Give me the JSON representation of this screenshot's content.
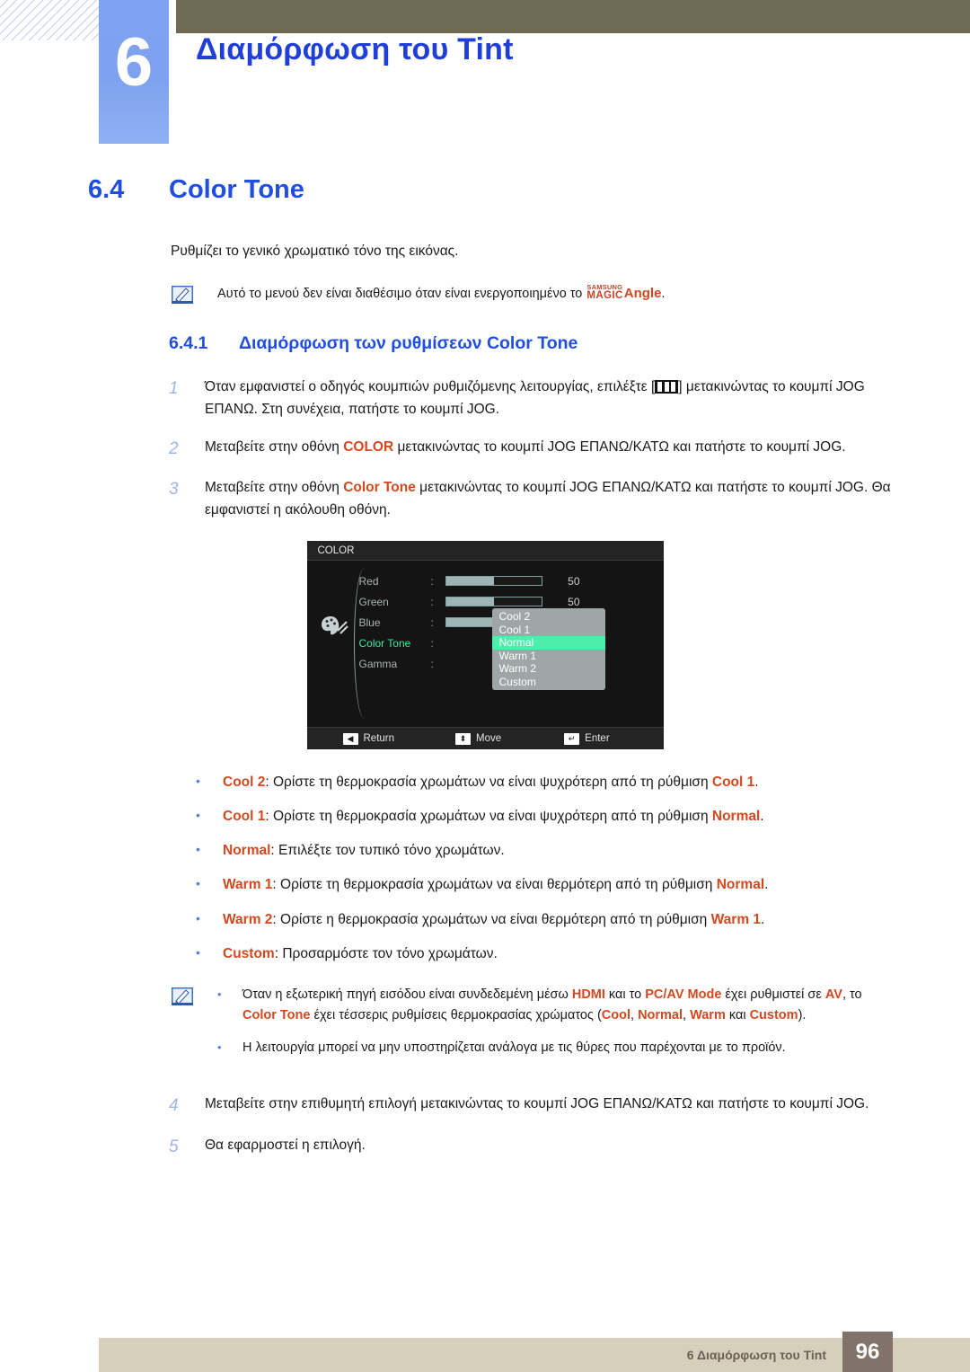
{
  "header": {
    "chapter_number": "6",
    "chapter_title": "Διαμόρφωση του Tint",
    "accent_blue": "#1f3fd8",
    "badge_blue": "#7fa3f0",
    "olive": "#6e6a53"
  },
  "section": {
    "number": "6.4",
    "title": "Color Tone",
    "intro": "Ρυθμίζει το γενικό χρωματικό τόνο της εικόνας."
  },
  "top_note": {
    "icon": "note-pencil-icon",
    "text_before": "Αυτό το μενού δεν είναι διαθέσιμο όταν είναι ενεργοποιημένο το ",
    "logo_line1": "SAMSUNG",
    "logo_line2": "MAGIC",
    "logo_word": "Angle",
    "text_after": "."
  },
  "subsection": {
    "number": "6.4.1",
    "title": "Διαμόρφωση των ρυθμίσεων Color Tone"
  },
  "steps_top": [
    {
      "num": "1",
      "part1": "Όταν εμφανιστεί ο οδηγός κουμπιών ρυθμιζόμενης λειτουργίας, επιλέξτε [",
      "icon": "jog-guide-icon",
      "part2": "] μετακινώντας το κουμπί JOG ΕΠΑΝΩ. Στη συνέχεια, πατήστε το κουμπί JOG."
    },
    {
      "num": "2",
      "part1": "Μεταβείτε στην οθόνη ",
      "highlight": "COLOR",
      "part2": " μετακινώντας το κουμπί JOG ΕΠΑΝΩ/ΚΑΤΩ και πατήστε το κουμπί JOG."
    },
    {
      "num": "3",
      "part1": "Μεταβείτε στην οθόνη ",
      "highlight": "Color Tone",
      "part2": " μετακινώντας το κουμπί JOG ΕΠΑΝΩ/ΚΑΤΩ και πατήστε το κουμπί JOG. Θα εμφανιστεί η ακόλουθη οθόνη."
    }
  ],
  "osd": {
    "title": "COLOR",
    "icon": "palette-icon",
    "rows": [
      {
        "label": "Red",
        "colon": ":",
        "value": "50",
        "fill": 50,
        "type": "slider",
        "active": false
      },
      {
        "label": "Green",
        "colon": ":",
        "value": "50",
        "fill": 50,
        "type": "slider",
        "active": false
      },
      {
        "label": "Blue",
        "colon": ":",
        "value": "50",
        "fill": 50,
        "type": "slider",
        "active": false
      },
      {
        "label": "Color Tone",
        "colon": ":",
        "value": "",
        "type": "dropdown",
        "active": true
      },
      {
        "label": "Gamma",
        "colon": ":",
        "value": "",
        "type": "none",
        "active": false
      }
    ],
    "dropdown_options": [
      "Cool 2",
      "Cool 1",
      "Normal",
      "Warm 1",
      "Warm 2",
      "Custom"
    ],
    "dropdown_selected": "Normal",
    "footer": [
      {
        "key": "◀",
        "label": "Return",
        "icon": "left-arrow-key-icon"
      },
      {
        "key": "⬍",
        "label": "Move",
        "icon": "up-down-arrow-key-icon"
      },
      {
        "key": "↵",
        "label": "Enter",
        "icon": "enter-key-icon"
      }
    ],
    "colors": {
      "background": "#141414",
      "titlebar": "#242424",
      "active_label": "#3ae8a2",
      "selected_row": "#4dedac",
      "dropdown_bg": "#9fa6a6"
    }
  },
  "bullets": [
    {
      "term": "Cool 2",
      "sep": ": ",
      "text": "Ορίστε τη θερμοκρασία χρωμάτων να είναι ψυχρότερη από τη ρύθμιση ",
      "term2": "Cool 1",
      "tail": "."
    },
    {
      "term": "Cool 1",
      "sep": ": ",
      "text": "Ορίστε τη θερμοκρασία χρωμάτων να είναι ψυχρότερη από τη ρύθμιση ",
      "term2": "Normal",
      "tail": "."
    },
    {
      "term": "Normal",
      "sep": ": ",
      "text": "Επιλέξτε τον τυπικό τόνο χρωμάτων.",
      "term2": "",
      "tail": ""
    },
    {
      "term": "Warm 1",
      "sep": ": ",
      "text": "Ορίστε τη θερμοκρασία χρωμάτων να είναι θερμότερη από τη ρύθμιση ",
      "term2": "Normal",
      "tail": "."
    },
    {
      "term": "Warm 2",
      "sep": ": ",
      "text": "Ορίστε η θερμοκρασία χρωμάτων να είναι θερμότερη από τη ρύθμιση ",
      "term2": "Warm 1",
      "tail": "."
    },
    {
      "term": "Custom",
      "sep": ": ",
      "text": "Προσαρμόστε τον τόνο χρωμάτων.",
      "term2": "",
      "tail": ""
    }
  ],
  "bottom_note": {
    "icon": "note-pencil-icon",
    "items": [
      {
        "p1": "Όταν η εξωτερική πηγή εισόδου είναι συνδεδεμένη μέσω ",
        "h1": "HDMI",
        "p2": " και το ",
        "h2": "PC/AV Mode",
        "p3": " έχει ρυθμιστεί σε ",
        "h3": "AV",
        "p4": ", το ",
        "h4": "Color Tone",
        "p5": " έχει τέσσερις ρυθμίσεις θερμοκρασίας χρώματος (",
        "h5": "Cool",
        "p6": ", ",
        "h6": "Normal",
        "p7": ", ",
        "h7": "Warm",
        "p8": " και ",
        "h8": "Custom",
        "p9": ")."
      },
      {
        "p1": "Η λειτουργία μπορεί να μην υποστηρίζεται ανάλογα με τις θύρες που παρέχονται με το προϊόν.",
        "h1": "",
        "p2": "",
        "h2": "",
        "p3": "",
        "h3": "",
        "p4": "",
        "h4": "",
        "p5": "",
        "h5": "",
        "p6": "",
        "h6": "",
        "p7": "",
        "h7": "",
        "p8": "",
        "h8": "",
        "p9": ""
      }
    ]
  },
  "steps_bottom": [
    {
      "num": "4",
      "text": "Μεταβείτε στην επιθυμητή επιλογή μετακινώντας το κουμπί JOG ΕΠΑΝΩ/ΚΑΤΩ και πατήστε το κουμπί JOG."
    },
    {
      "num": "5",
      "text": "Θα εφαρμοστεί η επιλογή."
    }
  ],
  "footer": {
    "text": "6 Διαμόρφωση του Tint",
    "page": "96",
    "bar_color": "#d5cfbc",
    "page_box_color": "#81736a"
  }
}
